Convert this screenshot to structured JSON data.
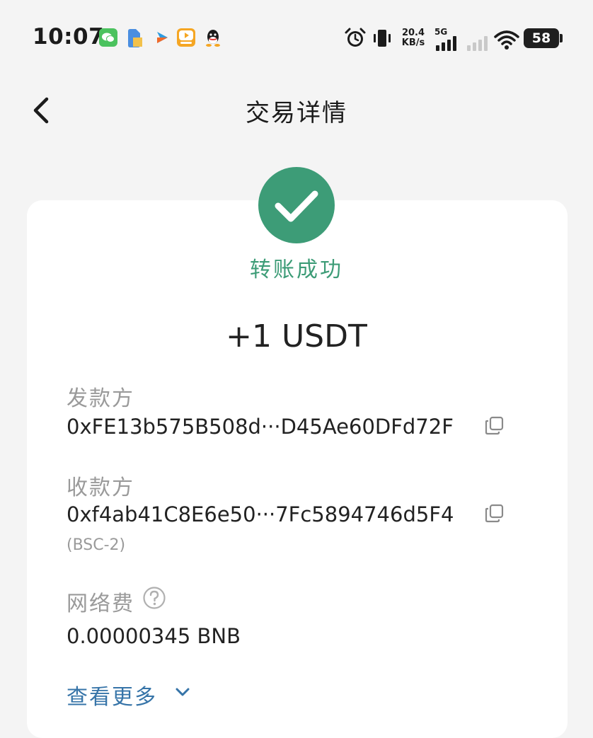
{
  "status_bar": {
    "time": "10:07",
    "netspeed_value": "20.4",
    "netspeed_unit": "KB/s",
    "network_type": "5G",
    "battery": "58",
    "notification_icons": [
      "wechat-icon",
      "files-icon",
      "video-arrow-icon",
      "video-app-icon",
      "qq-icon"
    ],
    "system_icons": [
      "alarm-icon",
      "vibrate-icon",
      "signal-icon",
      "signal-weak-icon",
      "wifi-icon",
      "battery-icon"
    ]
  },
  "nav": {
    "title": "交易详情",
    "back_icon": "chevron-left-icon"
  },
  "result": {
    "status_text": "转账成功",
    "status_icon": "checkmark-icon",
    "amount": "+1 USDT"
  },
  "sender": {
    "label": "发款方",
    "address": "0xFE13b575B508d···D45Ae60DFd72F",
    "copy_icon": "copy-icon"
  },
  "receiver": {
    "label": "收款方",
    "address": "0xf4ab41C8E6e50···7Fc5894746d5F4",
    "note": "(BSC-2)",
    "copy_icon": "copy-icon"
  },
  "fee": {
    "label": "网络费",
    "help_icon": "question-circle-icon",
    "value": "0.00000345 BNB"
  },
  "view_more": {
    "label": "查看更多",
    "icon": "chevron-down-icon"
  },
  "colors": {
    "success": "#3d9c77",
    "link": "#3674a8",
    "background": "#f4f4f4",
    "card": "#ffffff",
    "muted_text": "#9a9a9a"
  }
}
